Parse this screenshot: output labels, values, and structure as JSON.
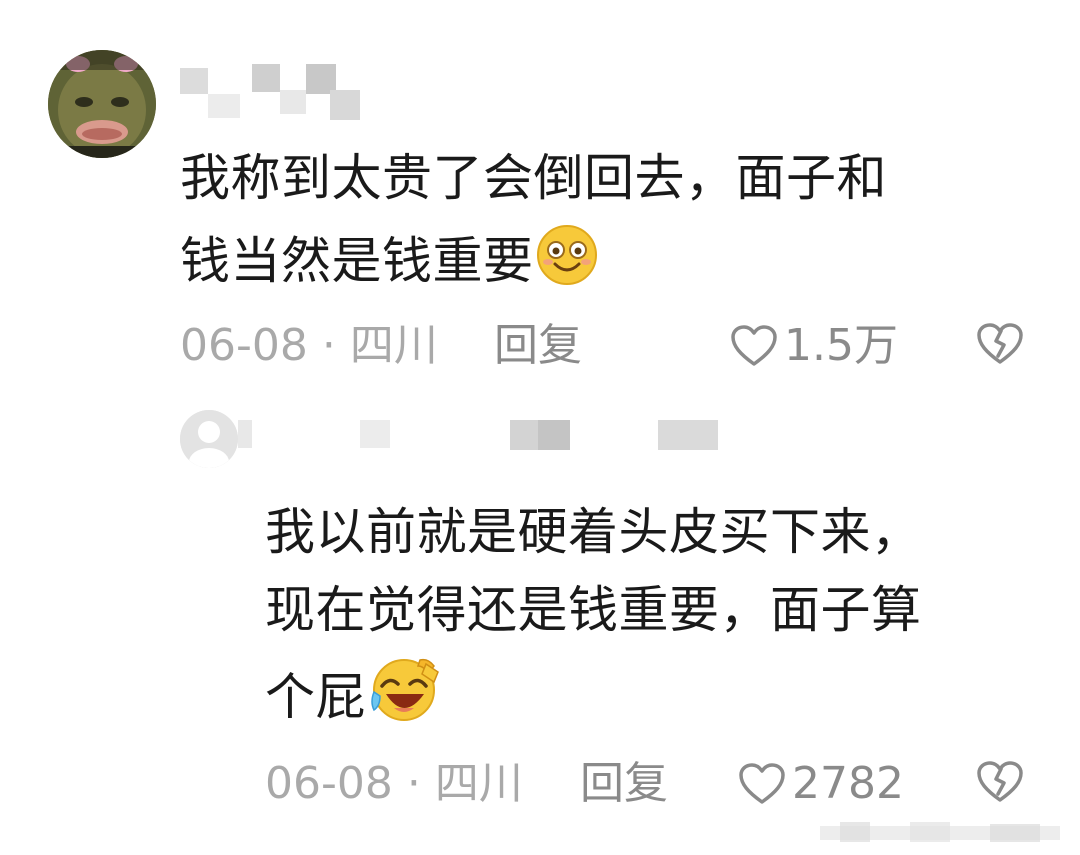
{
  "comment": {
    "text_line1": "我称到太贵了会倒回去，面子和",
    "text_line2": "钱当然是钱重要",
    "emoji": "smile-emoji",
    "date": "06-08",
    "location": "四川",
    "separator": "·",
    "reply_label": "回复",
    "likes": "1.5万"
  },
  "reply": {
    "text_line1": "我以前就是硬着头皮买下来，",
    "text_line2": "现在觉得还是钱重要，面子算",
    "text_line3": "个屁",
    "emoji": "laugh-cry-emoji",
    "date": "06-08",
    "location": "四川",
    "separator": "·",
    "reply_label": "回复",
    "likes": "2782"
  },
  "colors": {
    "text": "#1a1a1a",
    "meta": "#a9a9a9",
    "action": "#8a8a8a",
    "censor": "#d4d4d4"
  }
}
